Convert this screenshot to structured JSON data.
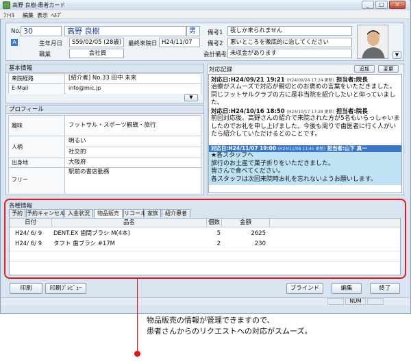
{
  "window": {
    "title": "高野 良樹-患者カード",
    "minimize": "_",
    "maximize": "□",
    "close": "×"
  },
  "menu": [
    "ﾌｧｲﾙ",
    "編集",
    "表示",
    "ﾍﾙﾌﾟ"
  ],
  "patient": {
    "no_label": "No.",
    "no": "30",
    "name": "高野 良樹",
    "sex": "男",
    "badge": "A",
    "birth_label": "生年月日",
    "birth": "S59/02/05 (28歳)",
    "last_visit_label": "最終来院日",
    "last_visit": "H24/11/07",
    "job_label": "職業",
    "job": "会社員",
    "note1_label": "備考1",
    "note1": "夜しか来られません",
    "note2_label": "備考2",
    "note2": "悪いところを徹底的に治してください",
    "company_note_label": "会計備考",
    "company_note": "未収金があります",
    "dropdown_arrow": "▼"
  },
  "basic": {
    "header": "基本情報",
    "rows": [
      {
        "label": "来院経路",
        "value": "[紹介者] No.33 田中 未来"
      },
      {
        "label": "E-Mail",
        "value": "info@mic.jp"
      }
    ],
    "dropdown_arrow": "▼"
  },
  "profile": {
    "header": "プロフィール",
    "hobby_label": "趣味",
    "hobby": "フットサル・スポーツ観戦・旅行",
    "personality_label": "人柄",
    "personality_1": "明るい",
    "personality_2": "社交的",
    "birthplace_label": "出身地",
    "birthplace": "大阪府",
    "free_label": "フリー",
    "free": "駅前の書店勤務"
  },
  "records": {
    "header": "対応記録",
    "add": "追加",
    "edit": "変更",
    "items": [
      {
        "head": "対応日:H24/09/21 19:21",
        "ts": "(H24/09/24 17:24 更新)",
        "staff": "担当者:院長",
        "body": "治療がスムーズで対応が親切とのお褒めの言葉をいただきました。同じフットサルクラブの方に是非当院を紹介したいと仰っていました。"
      },
      {
        "head": "対応日:H24/10/16 18:50",
        "ts": "(H24/10/17 17:28 更新)",
        "staff": "担当者:院長",
        "body": "前回対応後、高野さんの紹介で来院された方が5名もいらっしゃいましたのでお礼を申し上げました。今後も周りで歯医者に行く人がいたら紹介していただけるとのことです。"
      },
      {
        "head": "対応日:H24/11/07 19:00",
        "ts": "(H24/11/08 11:45 更新)",
        "staff": "担当者:山下 真一",
        "body": "★各スタッフへ\n旅行のお土産で菓子折りをいただきました。\n皆さんで食べてください。\n各スタッフは次回来院時お礼を忘れないようお願いします。"
      }
    ]
  },
  "misc": {
    "header": "各種情報",
    "tabs": [
      "予約",
      "予約キャンセル",
      "入金状況",
      "物品販売",
      "リコール",
      "家族",
      "紹介患者"
    ],
    "active_tab": "物品販売",
    "columns": [
      "日付",
      "品名",
      "個数",
      "金額"
    ],
    "rows": [
      {
        "date": "H24/ 6/ 9",
        "name": "DENT.EX 歯間ブラシ M(4本)",
        "qty": "5",
        "amount": "2625"
      },
      {
        "date": "H24/ 6/ 9",
        "name": "タフト 歯ブラシ #17M",
        "qty": "2",
        "amount": "230"
      }
    ]
  },
  "footer": {
    "print": "印刷",
    "preview": "印刷ﾌﾟﾚﾋﾞｭｰ",
    "blind": "ブラインド",
    "edit": "編集",
    "exit": "終了",
    "status_num": "NUM"
  },
  "caption": {
    "line1": "物品販売の情報が管理できますので、",
    "line2": "患者さんからのリクエストへの対応がスムーズ。"
  },
  "colors": {
    "accent_red": "#e0181c",
    "highlight": "#bfe3f5",
    "selected_head": "#3b78c8"
  }
}
